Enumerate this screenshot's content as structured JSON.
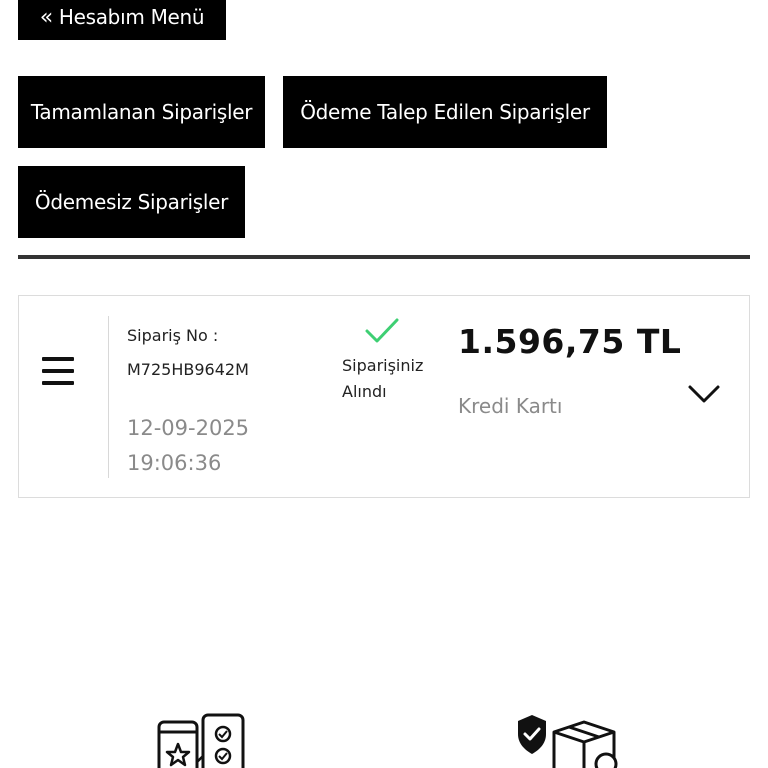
{
  "nav": {
    "back_chevron": "«",
    "back_label": "Hesabım Menü"
  },
  "filters": {
    "completed": "Tamamlanan Siparişler",
    "payment_requested": "Ödeme Talep Edilen Siparişler",
    "unpaid": "Ödemesiz Siparişler"
  },
  "order": {
    "order_no_label": "Sipariş No :",
    "order_no": "M725HB9642M",
    "date": "12-09-2025",
    "time": "19:06:36",
    "status_line1": "Siparişiniz",
    "status_line2": "Alındı",
    "status_icon": "check-icon",
    "status_color": "#3ecf73",
    "amount": "1.596,75 TL",
    "payment_method": "Kredi Kartı"
  },
  "colors": {
    "button_bg": "#000000",
    "button_text": "#ffffff",
    "muted_text": "#8a8a8a"
  },
  "icons": {
    "menu": "hamburger-menu-icon",
    "expand": "chevron-down-icon",
    "footer_1": "phone-rating-checklist-icon",
    "footer_2": "secure-delivery-box-icon"
  }
}
